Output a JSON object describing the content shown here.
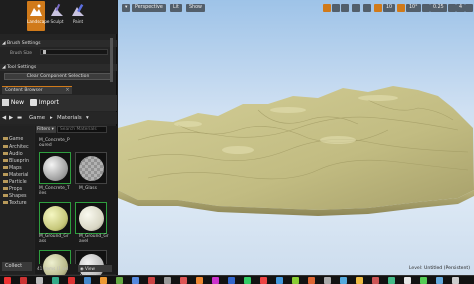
{
  "modes": [
    {
      "label": "Landscape",
      "icon": "landscape-icon",
      "active": true
    },
    {
      "label": "Sculpt",
      "icon": "sculpt-icon",
      "active": false
    },
    {
      "label": "Paint",
      "icon": "paint-icon",
      "active": false
    }
  ],
  "panel": {
    "brush_settings": "Brush Settings",
    "brush_size_label": "Brush Size",
    "tool_settings": "Tool Settings",
    "clear_selection": "Clear Component Selection"
  },
  "content_browser": {
    "tab": "Content Browser",
    "new_label": "New",
    "import_label": "Import",
    "path": [
      "Game",
      "Materials"
    ],
    "filters_label": "Filters",
    "search_placeholder": "Search Materials",
    "tree": [
      {
        "label": "Game"
      },
      {
        "label": "Architec"
      },
      {
        "label": "Audio"
      },
      {
        "label": "Blueprin"
      },
      {
        "label": "Maps"
      },
      {
        "label": "Material"
      },
      {
        "label": "Particle"
      },
      {
        "label": "Props"
      },
      {
        "label": "Shapes"
      },
      {
        "label": "Texture"
      }
    ],
    "assets": [
      {
        "label": "M_Concrete_Poured",
        "label_lines": [
          "M_Concrete_P",
          "oured"
        ]
      },
      {
        "label": "M_Concrete_Poured",
        "label_lines": [
          "M_Concrete_P",
          "oured"
        ]
      },
      {
        "label": "M_Concrete_Tiles",
        "label_lines": [
          "M_Concrete_T",
          "iles"
        ]
      },
      {
        "label": "M_Glass",
        "label_lines": [
          "M_Glass",
          ""
        ]
      },
      {
        "label": "M_Ground_Grass",
        "label_lines": [
          "M_Ground_Gr",
          "ass"
        ]
      },
      {
        "label": "M_Ground_Gravel",
        "label_lines": [
          "M_Ground_Gr",
          "avel"
        ]
      }
    ],
    "status": "41 items (1 sel",
    "view_options": "View Options",
    "collections_label": "Collect"
  },
  "viewport": {
    "perspective_label": "Perspective",
    "lit_label": "Lit",
    "show_label": "Show",
    "snap_value": "10",
    "rotate_value": "10°",
    "scale_value": "0.25",
    "camera_speed": "4",
    "level_label": "Level:",
    "level_name": "Untitled (Persistent)"
  },
  "colors": {
    "accent": "#d07a1a",
    "sky": "#cfe0f2",
    "terrain": "#c9c38a",
    "selection_border": "#2e9e3e"
  }
}
